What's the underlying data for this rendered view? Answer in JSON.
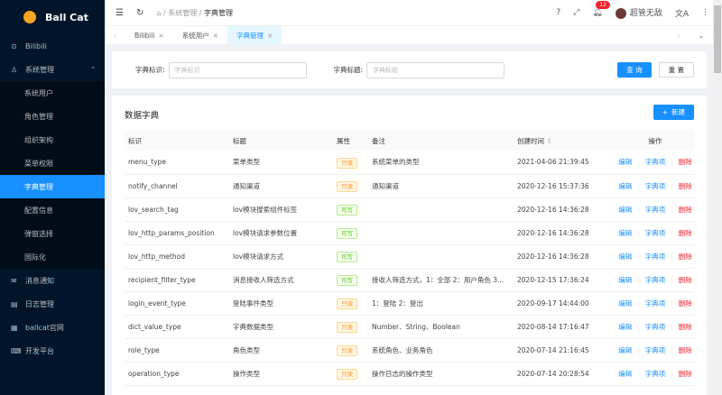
{
  "app": {
    "name": "Ball Cat"
  },
  "sidebar": {
    "items": [
      {
        "label": "Bilibili",
        "icon": "play-circle-icon"
      },
      {
        "label": "系统管理",
        "icon": "user-icon",
        "expanded": true,
        "children": [
          {
            "label": "系统用户"
          },
          {
            "label": "角色管理"
          },
          {
            "label": "组织架构"
          },
          {
            "label": "菜单权限"
          },
          {
            "label": "字典管理",
            "active": true
          },
          {
            "label": "配置信息"
          },
          {
            "label": "弹窗选择"
          },
          {
            "label": "国际化"
          }
        ]
      },
      {
        "label": "消息通知",
        "icon": "message-icon"
      },
      {
        "label": "日志管理",
        "icon": "file-icon"
      },
      {
        "label": "ballcat官网",
        "icon": "link-icon"
      },
      {
        "label": "开发平台",
        "icon": "code-icon"
      }
    ]
  },
  "header": {
    "breadcrumb": [
      "系统管理",
      "字典管理"
    ],
    "notifications": "12",
    "username": "超管无敌"
  },
  "tabs": [
    {
      "label": "Bilibili"
    },
    {
      "label": "系统用户"
    },
    {
      "label": "字典管理",
      "active": true
    }
  ],
  "search": {
    "key_label": "字典标识:",
    "key_placeholder": "字典标识",
    "title_label": "字典标题:",
    "title_placeholder": "字典标题",
    "query": "查 询",
    "reset": "重 置"
  },
  "table": {
    "title": "数据字典",
    "new": "新建",
    "columns": [
      "标识",
      "标题",
      "属性",
      "备注",
      "创建时间",
      "操作"
    ],
    "actions": {
      "edit": "编辑",
      "items": "字典项",
      "delete": "删除"
    },
    "rows": [
      {
        "code": "menu_type",
        "title": "菜单类型",
        "attr": "只读",
        "ro": true,
        "remark": "系统菜单的类型",
        "time": "2021-04-06 21:39:45"
      },
      {
        "code": "notify_channel",
        "title": "通知渠道",
        "attr": "只读",
        "ro": true,
        "remark": "通知渠道",
        "time": "2020-12-16 15:37:36"
      },
      {
        "code": "lov_search_tag",
        "title": "lov模块搜索组件标签",
        "attr": "可写",
        "ro": false,
        "remark": "",
        "time": "2020-12-16 14:36:28"
      },
      {
        "code": "lov_http_params_position",
        "title": "lov模块请求参数位置",
        "attr": "可写",
        "ro": false,
        "remark": "",
        "time": "2020-12-16 14:36:28"
      },
      {
        "code": "lov_http_method",
        "title": "lov模块请求方式",
        "attr": "可写",
        "ro": false,
        "remark": "",
        "time": "2020-12-16 14:36:28"
      },
      {
        "code": "recipient_filter_type",
        "title": "消息接收人筛选方式",
        "attr": "可写",
        "ro": false,
        "remark": "接收人筛选方式，1：全部 2：用户角色 3...",
        "time": "2020-12-15 17:36:24"
      },
      {
        "code": "login_event_type",
        "title": "登陆事件类型",
        "attr": "只读",
        "ro": true,
        "remark": "1：登陆 2：登出",
        "time": "2020-09-17 14:44:00"
      },
      {
        "code": "dict_value_type",
        "title": "字典数据类型",
        "attr": "只读",
        "ro": true,
        "remark": "Number、String、Boolean",
        "time": "2020-08-14 17:16:47"
      },
      {
        "code": "role_type",
        "title": "角色类型",
        "attr": "只读",
        "ro": true,
        "remark": "系统角色、业务角色",
        "time": "2020-07-14 21:16:45"
      },
      {
        "code": "operation_type",
        "title": "操作类型",
        "attr": "只读",
        "ro": true,
        "remark": "操作日志的操作类型",
        "time": "2020-07-14 20:28:54"
      }
    ]
  },
  "colors": {
    "primary": "#1890ff",
    "sidebar": "#001529",
    "danger": "#f5222d",
    "readonly": "#fa8c16",
    "writable": "#52c41a"
  }
}
